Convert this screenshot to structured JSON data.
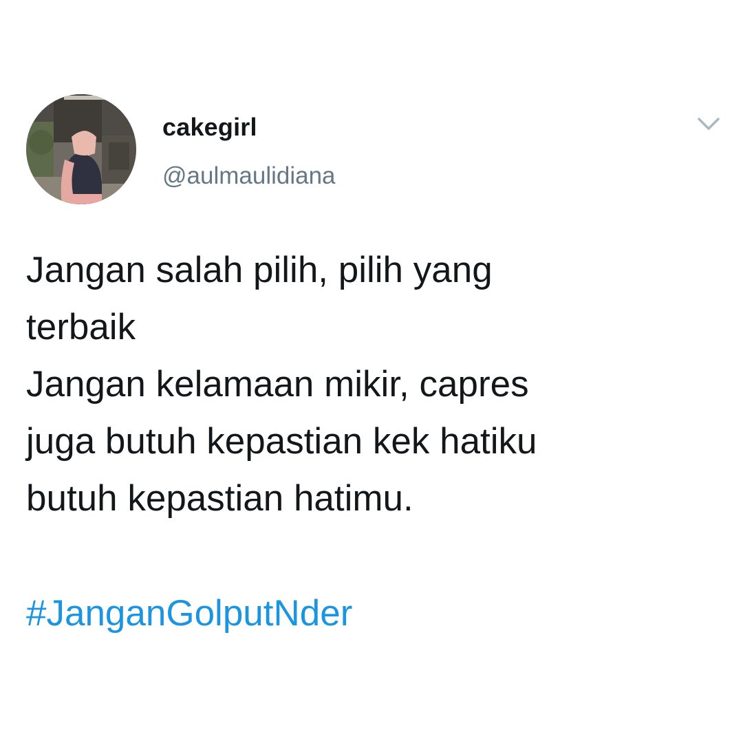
{
  "tweet": {
    "author": {
      "display_name": "cakegirl",
      "handle": "@aulmaulidiana",
      "avatar_icon": "profile-photo"
    },
    "menu_icon": "chevron-down-icon",
    "text_lines": [
      "Jangan salah pilih, pilih yang",
      "terbaik",
      "Jangan kelamaan mikir, capres",
      "juga butuh kepastian kek hatiku",
      "butuh kepastian hatimu."
    ],
    "hashtag": "#JanganGolputNder"
  },
  "colors": {
    "text": "#14171a",
    "secondary_text": "#657786",
    "link": "#1b95e0",
    "chevron": "#aab8c2",
    "background": "#ffffff"
  }
}
